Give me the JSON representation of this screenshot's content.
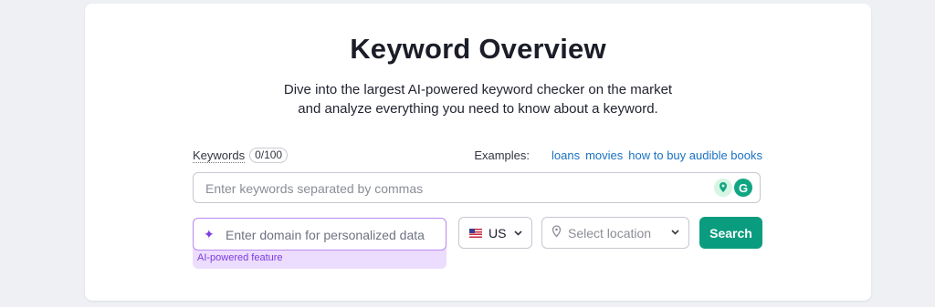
{
  "header": {
    "title": "Keyword Overview",
    "subtitle_line1": "Dive into the largest AI-powered keyword checker on the market",
    "subtitle_line2": "and analyze everything you need to know about a keyword."
  },
  "keywords": {
    "label": "Keywords",
    "counter": "0/100",
    "placeholder": "Enter keywords separated by commas"
  },
  "examples": {
    "label": "Examples:",
    "links": [
      "loans",
      "movies",
      "how to buy audible books"
    ]
  },
  "domain": {
    "placeholder": "Enter domain for personalized data",
    "note": "AI-powered feature"
  },
  "country": {
    "value": "US",
    "flag_icon": "us-flag-icon"
  },
  "location": {
    "placeholder": "Select location",
    "icon": "pin-icon"
  },
  "search_button": {
    "label": "Search",
    "color": "#0a9c7e"
  },
  "accent_colors": {
    "ai_purple": "#7b3ee0",
    "link_blue": "#1a72c2"
  }
}
